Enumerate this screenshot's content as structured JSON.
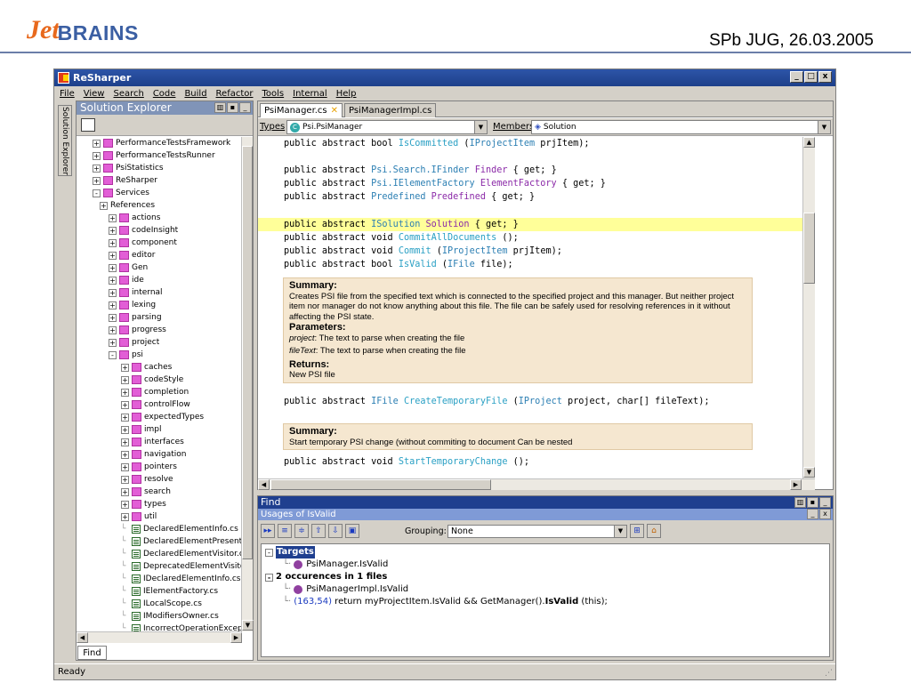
{
  "slide": {
    "logo_prefix": "Jet",
    "logo_suffix": "BRAINS",
    "title": "SPb JUG, 26.03.2005"
  },
  "window": {
    "title": "ReSharper",
    "btn_min": "_",
    "btn_max": "□",
    "btn_close": "x"
  },
  "menu": [
    "File",
    "View",
    "Search",
    "Code",
    "Build",
    "Refactor",
    "Tools",
    "Internal",
    "Help"
  ],
  "side_tab": "Solution Explorer",
  "solution_explorer": {
    "title": "Solution Explorer",
    "items": [
      {
        "label": "PerformanceTestsFramework",
        "kind": "folder",
        "level": 0,
        "exp": "+"
      },
      {
        "label": "PerformanceTestsRunner",
        "kind": "folder",
        "level": 0,
        "exp": "+"
      },
      {
        "label": "PsiStatistics",
        "kind": "folder",
        "level": 0,
        "exp": "+"
      },
      {
        "label": "ReSharper",
        "kind": "folder",
        "level": 0,
        "exp": "+"
      },
      {
        "label": "Services",
        "kind": "folder",
        "level": 0,
        "exp": "-"
      },
      {
        "label": "References",
        "kind": "ref",
        "level": 1,
        "exp": "+"
      },
      {
        "label": "actions",
        "kind": "folder",
        "level": 1,
        "exp": "+"
      },
      {
        "label": "codeInsight",
        "kind": "folder",
        "level": 1,
        "exp": "+"
      },
      {
        "label": "component",
        "kind": "folder",
        "level": 1,
        "exp": "+"
      },
      {
        "label": "editor",
        "kind": "folder",
        "level": 1,
        "exp": "+"
      },
      {
        "label": "Gen",
        "kind": "folder",
        "level": 1,
        "exp": "+"
      },
      {
        "label": "ide",
        "kind": "folder",
        "level": 1,
        "exp": "+"
      },
      {
        "label": "internal",
        "kind": "folder",
        "level": 1,
        "exp": "+"
      },
      {
        "label": "lexing",
        "kind": "folder",
        "level": 1,
        "exp": "+"
      },
      {
        "label": "parsing",
        "kind": "folder",
        "level": 1,
        "exp": "+"
      },
      {
        "label": "progress",
        "kind": "folder",
        "level": 1,
        "exp": "+"
      },
      {
        "label": "project",
        "kind": "folder",
        "level": 1,
        "exp": "+"
      },
      {
        "label": "psi",
        "kind": "folder",
        "level": 1,
        "exp": "-"
      },
      {
        "label": "caches",
        "kind": "folder",
        "level": 2,
        "exp": "+"
      },
      {
        "label": "codeStyle",
        "kind": "folder",
        "level": 2,
        "exp": "+"
      },
      {
        "label": "completion",
        "kind": "folder",
        "level": 2,
        "exp": "+"
      },
      {
        "label": "controlFlow",
        "kind": "folder",
        "level": 2,
        "exp": "+"
      },
      {
        "label": "expectedTypes",
        "kind": "folder",
        "level": 2,
        "exp": "+"
      },
      {
        "label": "impl",
        "kind": "folder",
        "level": 2,
        "exp": "+"
      },
      {
        "label": "interfaces",
        "kind": "folder",
        "level": 2,
        "exp": "+"
      },
      {
        "label": "navigation",
        "kind": "folder",
        "level": 2,
        "exp": "+"
      },
      {
        "label": "pointers",
        "kind": "folder",
        "level": 2,
        "exp": "+"
      },
      {
        "label": "resolve",
        "kind": "folder",
        "level": 2,
        "exp": "+"
      },
      {
        "label": "search",
        "kind": "folder",
        "level": 2,
        "exp": "+"
      },
      {
        "label": "types",
        "kind": "folder",
        "level": 2,
        "exp": "+"
      },
      {
        "label": "util",
        "kind": "folder",
        "level": 2,
        "exp": "+"
      },
      {
        "label": "DeclaredElementInfo.cs",
        "kind": "file",
        "level": 2,
        "exp": ""
      },
      {
        "label": "DeclaredElementPresente",
        "kind": "file",
        "level": 2,
        "exp": ""
      },
      {
        "label": "DeclaredElementVisitor.cs",
        "kind": "file",
        "level": 2,
        "exp": ""
      },
      {
        "label": "DeprecatedElementVisitor",
        "kind": "file",
        "level": 2,
        "exp": ""
      },
      {
        "label": "IDeclaredElementInfo.cs",
        "kind": "file",
        "level": 2,
        "exp": ""
      },
      {
        "label": "IElementFactory.cs",
        "kind": "file",
        "level": 2,
        "exp": ""
      },
      {
        "label": "ILocalScope.cs",
        "kind": "file",
        "level": 2,
        "exp": ""
      },
      {
        "label": "IModifiersOwner.cs",
        "kind": "file",
        "level": 2,
        "exp": ""
      },
      {
        "label": "IncorrectOperationExcep",
        "kind": "file",
        "level": 2,
        "exp": ""
      }
    ]
  },
  "find_tab": "Find",
  "status": "Ready",
  "editor": {
    "tabs": [
      {
        "label": "PsiManager.cs",
        "close": "✕"
      },
      {
        "label": "PsiManagerImpl.cs"
      }
    ],
    "types_label": "Types",
    "types_value": "Psi.PsiManager",
    "types_icon": "C",
    "members_label": "Members",
    "members_value": "Solution",
    "code_lines": [
      {
        "parts": [
          [
            "public abstract bool ",
            "kw"
          ],
          [
            "IsCommitted",
            "nm"
          ],
          [
            " (",
            "kw"
          ],
          [
            "IProjectItem",
            "tp"
          ],
          [
            " prjItem);",
            "kw"
          ]
        ]
      },
      {
        "parts": [
          [
            "public abstract ",
            "kw"
          ],
          [
            "Psi.Search.IFinder",
            "tp"
          ],
          [
            " ",
            "kw"
          ],
          [
            "Finder",
            "prop"
          ],
          [
            " { get; }",
            "kw"
          ]
        ]
      },
      {
        "parts": [
          [
            "public abstract ",
            "kw"
          ],
          [
            "Psi.IElementFactory",
            "tp"
          ],
          [
            " ",
            "kw"
          ],
          [
            "ElementFactory",
            "prop"
          ],
          [
            " { get; }",
            "kw"
          ]
        ]
      },
      {
        "parts": [
          [
            "public abstract ",
            "kw"
          ],
          [
            "Predefined",
            "tp"
          ],
          [
            " ",
            "kw"
          ],
          [
            "Predefined",
            "prop"
          ],
          [
            " { get; }",
            "kw"
          ]
        ]
      },
      {
        "parts": [
          [
            "public abstract ",
            "kw"
          ],
          [
            "ISolution",
            "tp"
          ],
          [
            " ",
            "kw"
          ],
          [
            "Solution",
            "prop"
          ],
          [
            " { get; }",
            "kw"
          ]
        ]
      },
      {
        "parts": [
          [
            "public abstract void ",
            "kw"
          ],
          [
            "CommitAllDocuments",
            "nm"
          ],
          [
            " ();",
            "kw"
          ]
        ]
      },
      {
        "parts": [
          [
            "public abstract void ",
            "kw"
          ],
          [
            "Commit",
            "nm"
          ],
          [
            " (",
            "kw"
          ],
          [
            "IProjectItem",
            "tp"
          ],
          [
            " prjItem);",
            "kw"
          ]
        ]
      },
      {
        "parts": [
          [
            "public abstract bool ",
            "kw"
          ],
          [
            "IsValid",
            "nm"
          ],
          [
            " (",
            "kw"
          ],
          [
            "IFile",
            "tp"
          ],
          [
            " file);",
            "kw"
          ]
        ]
      },
      {
        "parts": [
          [
            "public abstract ",
            "kw"
          ],
          [
            "IFile",
            "tp"
          ],
          [
            " ",
            "kw"
          ],
          [
            "CreateTemporaryFile",
            "nm"
          ],
          [
            " (",
            "kw"
          ],
          [
            "IProject",
            "tp"
          ],
          [
            " project, char[] fileText);",
            "kw"
          ]
        ]
      },
      {
        "parts": [
          [
            "public abstract void ",
            "kw"
          ],
          [
            "StartTemporaryChange",
            "nm"
          ],
          [
            " ();",
            "kw"
          ]
        ]
      }
    ],
    "doc1": {
      "summary_h": "Summary:",
      "summary": "Creates PSI file from the specified text which is connected to the specified project and this manager. But neither project item nor manager do not know anything about this file. The file can be safely used for resolving references in it without affecting the PSI state.",
      "params_h": "Parameters:",
      "p1_name": "project",
      "p1_desc": ": The text to parse when creating the file",
      "p2_name": "fileText",
      "p2_desc": ": The text to parse when creating the file",
      "returns_h": "Returns:",
      "returns": "New PSI file"
    },
    "doc2": {
      "summary_h": "Summary:",
      "summary": "Start temporary PSI change (without commiting to document Can be nested"
    }
  },
  "find": {
    "title": "Find",
    "usages_title": "Usages of IsValid",
    "grouping_label": "Grouping:",
    "grouping_value": "None",
    "results": {
      "targets": "Targets",
      "target_item": "PsiManager.IsValid",
      "occ": "2 occurences in 1 files",
      "occ_item": "PsiManagerImpl.IsValid",
      "loc": "(163,54)",
      "line_pre": " return myProjectItem.IsValid && GetManager().",
      "line_bold": "IsValid",
      "line_post": " (this);"
    }
  }
}
